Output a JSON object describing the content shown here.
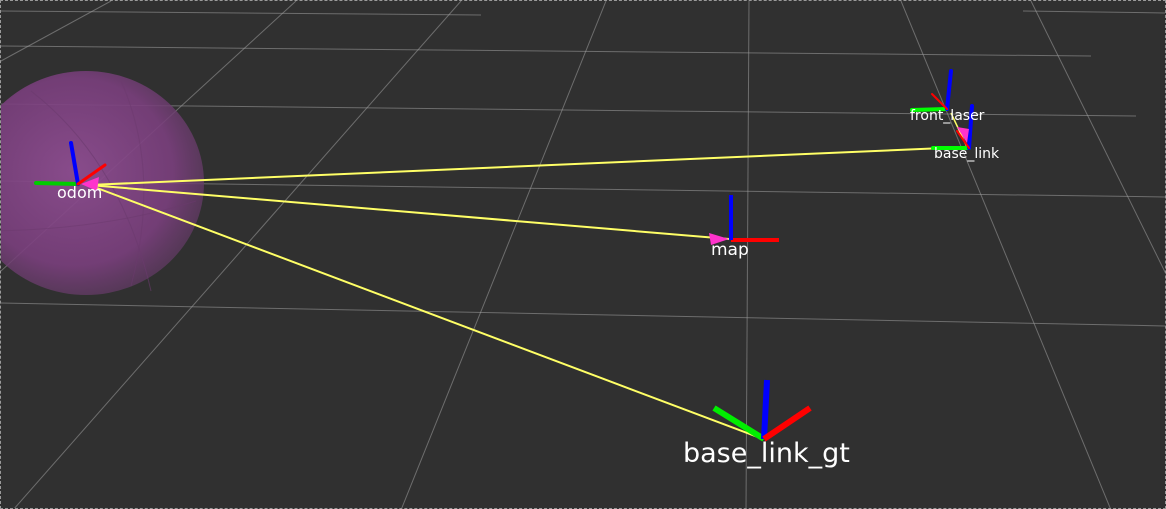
{
  "viewer": {
    "frames": {
      "odom": "odom",
      "map": "map",
      "base_link": "base_link",
      "front_laser": "front_laser",
      "base_link_gt": "base_link_gt"
    },
    "colors": {
      "background": "#303030",
      "grid": "#a0a0a0",
      "axis_x": "#ff0000",
      "axis_y": "#00ff00",
      "axis_z": "#0000ff",
      "tf_link": "#ffff66",
      "tf_arrow": "#ff33cc",
      "covariance_sphere": "#8a4a8c"
    }
  }
}
